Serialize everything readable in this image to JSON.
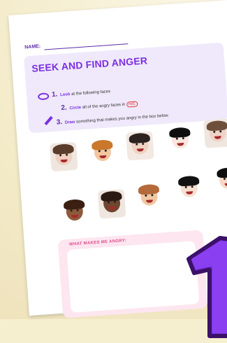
{
  "page": {
    "name_label": "NAME:",
    "title": "SEEK AND FIND ANGER",
    "steps": [
      {
        "num": "1.",
        "kw": "Look",
        "rest": " at the following faces",
        "icon": "eye-icon"
      },
      {
        "num": "2.",
        "kw": "Circle",
        "rest": " all of the angry faces in ",
        "red": "red.",
        "icon": ""
      },
      {
        "num": "3.",
        "kw": "Draw",
        "rest": " something that makes you angry in the box below.",
        "icon": "pencil-icon"
      }
    ],
    "box_title": "WHAT MAKES ME ANGRY:",
    "faces": [
      {
        "name": "girl-shouting-photo",
        "bg": "#efe7df",
        "skin": "#f0cfc0",
        "hair": "#5a3c2a"
      },
      {
        "name": "boy-cartoon",
        "bg": "#ffffff",
        "skin": "#f2c7a0",
        "hair": "#c9782c"
      },
      {
        "name": "girl-smiling-photo",
        "bg": "#f3e8e2",
        "skin": "#f1d3c2",
        "hair": "#2c2320"
      },
      {
        "name": "angry-girl-cartoon",
        "bg": "#ffffff",
        "skin": "#fbe7df",
        "hair": "#0f0f10"
      },
      {
        "name": "girl-surprised-photo",
        "bg": "#efe7df",
        "skin": "#f1d2c6",
        "hair": "#6e4f3c"
      },
      {
        "name": "girl-curly-cartoon",
        "bg": "#ffffff",
        "skin": "#8d5a3c",
        "hair": "#3b1f13"
      },
      {
        "name": "boy-laughing-photo",
        "bg": "#efe7df",
        "skin": "#6f4630",
        "hair": "#2b1a12"
      },
      {
        "name": "girl-smile-cartoon",
        "bg": "#ffffff",
        "skin": "#f1c8a4",
        "hair": "#b46a3a"
      },
      {
        "name": "worried-boy-cartoon",
        "bg": "#ffffff",
        "skin": "#f6e0d0",
        "hair": "#121212"
      },
      {
        "name": "girl-buns-cartoon",
        "bg": "#ffffff",
        "skin": "#f7d7c5",
        "hair": "#0f0f10"
      }
    ],
    "colors": {
      "purple": "#7b2fe0",
      "pink": "#e04a8c",
      "red": "#e13b3b"
    }
  }
}
